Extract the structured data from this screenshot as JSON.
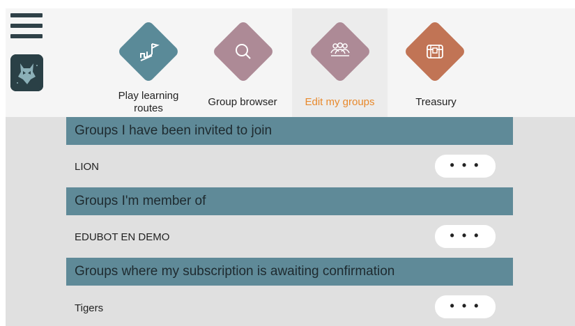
{
  "nav": {
    "items": [
      {
        "label_line1": "Play learning",
        "label_line2": "routes",
        "icon": "flag-route-icon",
        "color": "#5a8a98"
      },
      {
        "label": "Group browser",
        "icon": "search-icon",
        "color": "#ad8a96"
      },
      {
        "label": "Edit my groups",
        "icon": "group-icon",
        "color": "#ad8a96",
        "active": true
      },
      {
        "label": "Treasury",
        "icon": "treasure-chest-icon",
        "color": "#c17455"
      }
    ]
  },
  "sections": [
    {
      "title": "Groups I have been invited to join",
      "rows": [
        {
          "name": "LION",
          "more": "• • •"
        }
      ]
    },
    {
      "title": "Groups I'm member of",
      "rows": [
        {
          "name": "EDUBOT EN DEMO",
          "more": "• • •"
        }
      ]
    },
    {
      "title": "Groups where my subscription is awaiting confirmation",
      "rows": [
        {
          "name": "Tigers",
          "more": "• • •"
        }
      ]
    }
  ],
  "colors": {
    "header_band": "#5f8a98",
    "active_label": "#e8892c",
    "content_bg": "#e0e0e0",
    "topbar_bg": "#f5f5f5"
  }
}
